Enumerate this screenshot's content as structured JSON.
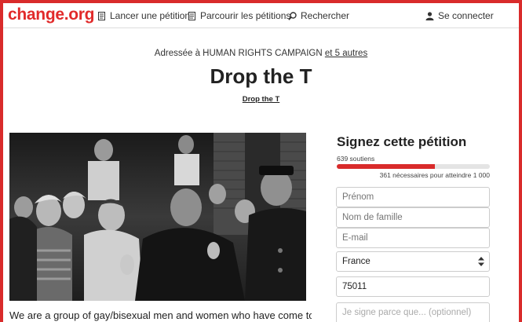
{
  "header": {
    "logo": "change.org",
    "nav": {
      "start_petition": "Lancer une pétition",
      "browse": "Parcourir les pétitions",
      "search": "Rechercher",
      "login": "Se connecter"
    },
    "icons": {
      "start_petition": "document-icon",
      "browse": "document-icon",
      "search": "search-icon",
      "login": "user-icon"
    },
    "brand_color": "#d92b2b"
  },
  "petition": {
    "addressed_prefix": "Adressée à HUMAN RIGHTS CAMPAIGN",
    "addressed_more": "et 5 autres",
    "title": "Drop the T",
    "author": "Drop the T",
    "body_start": "We are a group of gay/bisexual men and women who have come to the"
  },
  "sign": {
    "title": "Signez cette pétition",
    "supporters": "639 soutiens",
    "progress_fraction": 0.639,
    "needed": "361 nécessaires pour atteindre 1 000",
    "first_name_placeholder": "Prénom",
    "last_name_placeholder": "Nom de famille",
    "email_placeholder": "E-mail",
    "country": "France",
    "postal_code": "75011",
    "reason_placeholder": "Je signe parce que... (optionnel)"
  }
}
